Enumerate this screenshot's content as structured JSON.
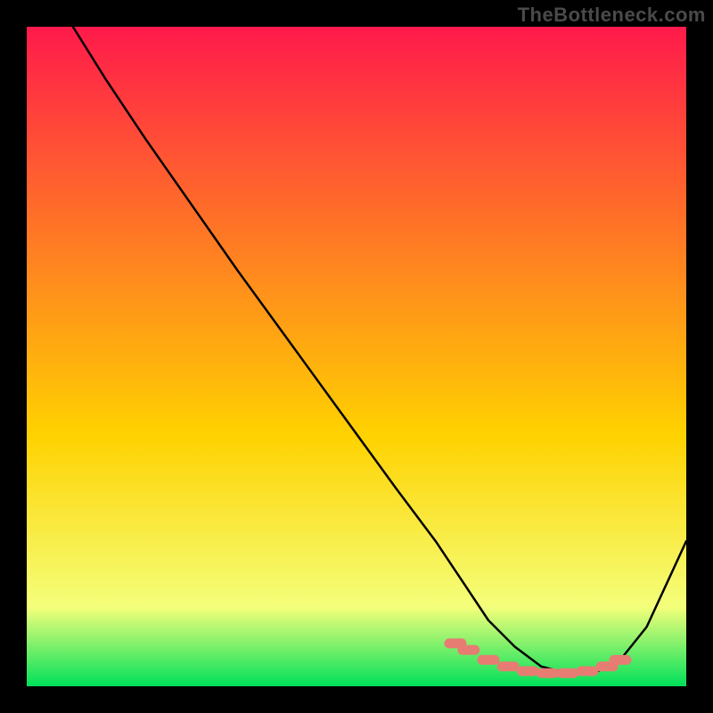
{
  "watermark": "TheBottleneck.com",
  "chart_data": {
    "type": "line",
    "title": "",
    "xlabel": "",
    "ylabel": "",
    "xlim": [
      0,
      100
    ],
    "ylim": [
      0,
      100
    ],
    "grid": false,
    "legend": false,
    "gradient": {
      "top_color": "#ff1a4b",
      "mid_color": "#ffd200",
      "bottom_color": "#00e05a"
    },
    "series": [
      {
        "name": "bottleneck-curve",
        "color": "#000000",
        "x": [
          7,
          12,
          18,
          25,
          32,
          40,
          48,
          56,
          62,
          66,
          70,
          74,
          78,
          82,
          86,
          90,
          94,
          100
        ],
        "y": [
          100,
          92,
          83,
          73,
          63,
          52,
          41,
          30,
          22,
          16,
          10,
          6,
          3,
          2,
          2,
          4,
          9,
          22
        ]
      }
    ],
    "markers": {
      "name": "highlight-points",
      "color": "#e77c72",
      "x": [
        65,
        67,
        70,
        73,
        76,
        79,
        82,
        85,
        88,
        90
      ],
      "y": [
        6.5,
        5.5,
        4.0,
        3.0,
        2.3,
        2.0,
        2.0,
        2.3,
        3.0,
        4.0
      ]
    }
  }
}
